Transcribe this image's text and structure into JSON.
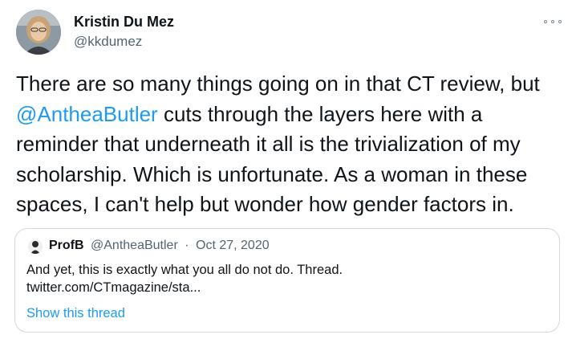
{
  "author": {
    "name": "Kristin Du Mez",
    "handle": "@kkdumez"
  },
  "tweet": {
    "text_before": "There are so many things going on in that CT review, but ",
    "mention": "@AntheaButler",
    "text_after": " cuts through the layers here with a reminder that underneath it all is the trivialization of my scholarship. Which is unfortunate. As a woman in these spaces, I can't help but wonder how gender factors in."
  },
  "quoted": {
    "name": "ProfB",
    "handle": "@AntheaButler",
    "separator": "·",
    "date": "Oct 27, 2020",
    "text": "And yet, this is exactly what you all do not do. Thread.",
    "link": "twitter.com/CTmagazine/sta...",
    "show_thread": "Show this thread"
  },
  "colors": {
    "accent": "#1d9bf0",
    "secondary_text": "#536471",
    "border": "#cfd9de"
  },
  "icons": {
    "more": "more-options-icon"
  }
}
